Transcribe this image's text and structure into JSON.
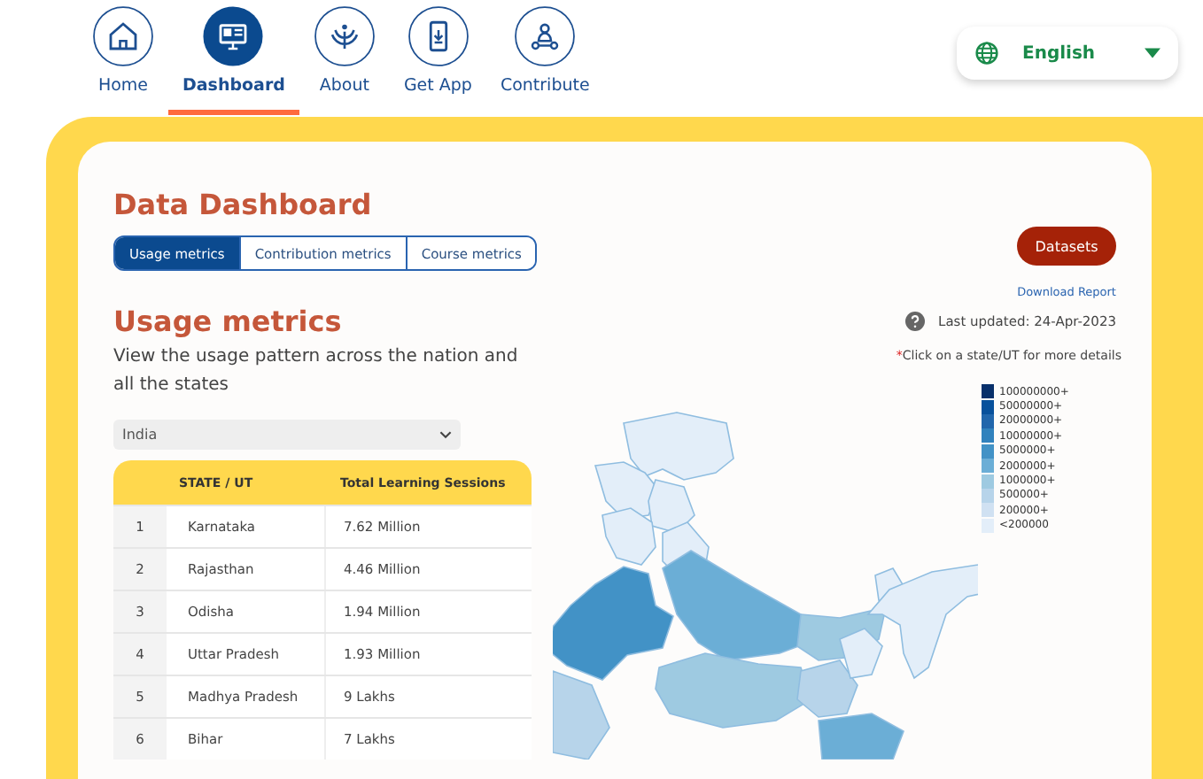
{
  "nav": [
    {
      "label": "Home",
      "selected": false
    },
    {
      "label": "Dashboard",
      "selected": true
    },
    {
      "label": "About",
      "selected": false
    },
    {
      "label": "Get App",
      "selected": false
    },
    {
      "label": "Contribute",
      "selected": false
    }
  ],
  "language": {
    "value": "English"
  },
  "title": "Data Dashboard",
  "tabs": [
    {
      "label": "Usage metrics",
      "selected": true
    },
    {
      "label": "Contribution metrics",
      "selected": false
    },
    {
      "label": "Course metrics",
      "selected": false
    }
  ],
  "datasets_button": "Datasets",
  "download_link": "Download Report",
  "last_updated": "Last updated: 24-Apr-2023",
  "click_hint_mark": "*",
  "click_hint": "Click on a state/UT for more details",
  "section_title": "Usage metrics",
  "section_description": "View the usage pattern across the nation and all the states",
  "region_select": {
    "value": "India"
  },
  "table": {
    "columns": [
      "STATE / UT",
      "Total Learning Sessions"
    ],
    "rows": [
      {
        "rank": "1",
        "state": "Karnataka",
        "sessions": "7.62 Million"
      },
      {
        "rank": "2",
        "state": "Rajasthan",
        "sessions": "4.46 Million"
      },
      {
        "rank": "3",
        "state": "Odisha",
        "sessions": "1.94 Million"
      },
      {
        "rank": "4",
        "state": "Uttar Pradesh",
        "sessions": "1.93 Million"
      },
      {
        "rank": "5",
        "state": "Madhya Pradesh",
        "sessions": "9 Lakhs"
      },
      {
        "rank": "6",
        "state": "Bihar",
        "sessions": "7 Lakhs"
      }
    ]
  },
  "legend": [
    {
      "label": "100000000+",
      "color": "#08306b"
    },
    {
      "label": "50000000+",
      "color": "#08519c"
    },
    {
      "label": "20000000+",
      "color": "#2166ac"
    },
    {
      "label": "10000000+",
      "color": "#3182bd"
    },
    {
      "label": "5000000+",
      "color": "#4292c6"
    },
    {
      "label": "2000000+",
      "color": "#6baed6"
    },
    {
      "label": "1000000+",
      "color": "#9ecae1"
    },
    {
      "label": "500000+",
      "color": "#b7d4ea"
    },
    {
      "label": "200000+",
      "color": "#d0e1f2"
    },
    {
      "label": "<200000",
      "color": "#e3eef9"
    }
  ]
}
